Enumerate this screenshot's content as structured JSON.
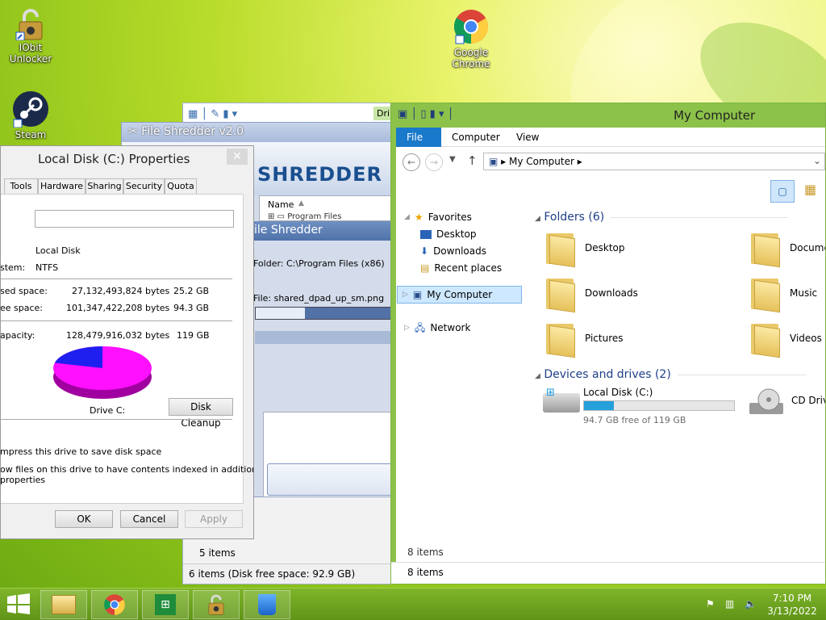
{
  "desktop": {
    "icons": [
      {
        "label": "IObit Unlocker",
        "line1": "IObit",
        "line2": "Unlocker"
      },
      {
        "label": "Steam",
        "line1": "Steam",
        "line2": ""
      },
      {
        "label": "Google Chrome",
        "line1": "Google",
        "line2": "Chrome"
      }
    ]
  },
  "shredder_bg": {
    "title": "File Shredder v2.0",
    "logo": "SHREDDER",
    "column_name": "Name",
    "row1": "Program Files",
    "subtitle": "ile Shredder",
    "folder_text": "Folder: C:\\Program Files (x86)",
    "file_text": "File: shared_dpad_up_sm.png",
    "status_items": "5 items",
    "status_disk": "6 items (Disk free space: 92.9 GB)",
    "toolbar_trail": "Dri"
  },
  "properties": {
    "title": "Local Disk (C:) Properties",
    "tabs": [
      "Tools",
      "Hardware",
      "Sharing",
      "Security",
      "Quota"
    ],
    "name_value": "",
    "type_value": "Local Disk",
    "filesystem_label": "stem:",
    "filesystem_value": "NTFS",
    "used_label": "sed space:",
    "used_bytes": "27,132,493,824 bytes",
    "used_gb": "25.2 GB",
    "free_label": "ee space:",
    "free_bytes": "101,347,422,208 bytes",
    "free_gb": "94.3 GB",
    "capacity_label": "apacity:",
    "capacity_bytes": "128,479,916,032 bytes",
    "capacity_gb": "119 GB",
    "used_fraction": 0.211,
    "drive_label": "Drive C:",
    "cleanup_button": "Disk Cleanup",
    "compress_text": "mpress this drive to save disk space",
    "index_line1": "ow files on this drive to have contents indexed in addition to",
    "index_line2": "properties",
    "ok_button": "OK",
    "cancel_button": "Cancel",
    "apply_button": "Apply",
    "colors": {
      "used": "#1f1ff0",
      "free": "#ff10ff"
    }
  },
  "explorer": {
    "title": "My Computer",
    "ribbon_tabs": {
      "file": "File",
      "computer": "Computer",
      "view": "View"
    },
    "address": "My Computer",
    "nav": {
      "favorites": "Favorites",
      "desktop": "Desktop",
      "downloads": "Downloads",
      "recent": "Recent places",
      "my_computer": "My Computer",
      "network": "Network"
    },
    "folders_header": "Folders (6)",
    "folders": [
      "Desktop",
      "Documen",
      "Downloads",
      "Music",
      "Pictures",
      "Videos"
    ],
    "devices_header": "Devices and drives (2)",
    "drive": {
      "name": "Local Disk (C:)",
      "free_text": "94.7 GB free of 119 GB",
      "used_fraction": 0.2
    },
    "cd_drive": "CD Drive",
    "status_inner": "8 items",
    "status_bottom": "8 items",
    "accent": "#8cc249"
  },
  "taskbar": {
    "time": "7:10 PM",
    "date": "3/13/2022"
  }
}
